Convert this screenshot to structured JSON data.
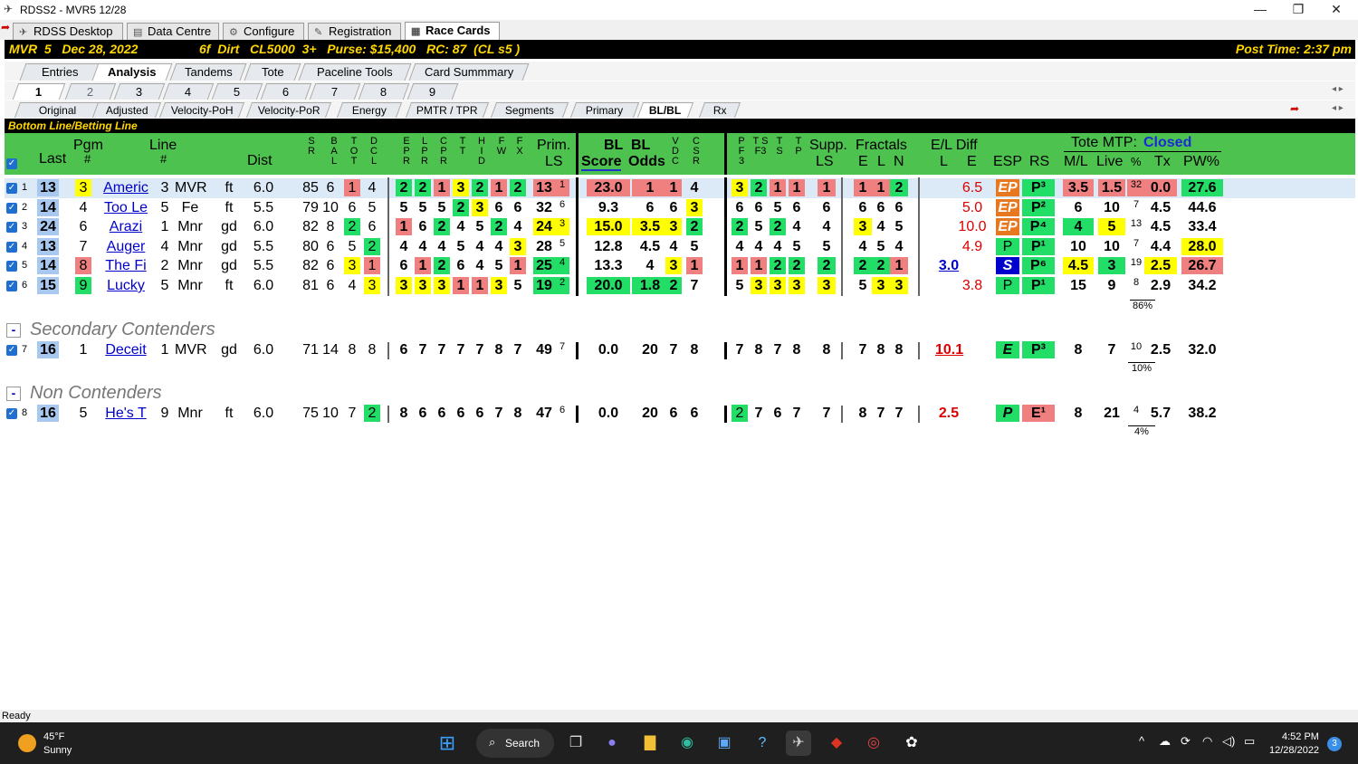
{
  "window": {
    "title": "RDSS2 - MVR5  12/28",
    "controls": [
      "—",
      "❐",
      "✕"
    ]
  },
  "app_tabs": [
    "RDSS Desktop",
    "Data Centre",
    "Configure",
    "Registration",
    "Race Cards"
  ],
  "race": {
    "info": "MVR  5   Dec 28, 2022",
    "cond": "6f  Dirt   CL5000  3+   Purse: $15,400   RC: 87  (CL s5 )",
    "post": "Post Time: 2:37 pm"
  },
  "view_tabs": [
    "Entries",
    "Analysis",
    "Tandems",
    "Tote",
    "Paceline Tools",
    "Card Summmary"
  ],
  "race_tabs": [
    "1",
    "2",
    "3",
    "4",
    "5",
    "6",
    "7",
    "8",
    "9"
  ],
  "sub_tabs": [
    "Original",
    "Adjusted",
    "Velocity-PoH",
    "Velocity-PoR",
    "Energy",
    "PMTR / TPR",
    "Segments",
    "Primary",
    "BL/BL",
    "Rx"
  ],
  "section_title": "Bottom Line/Betting Line",
  "headers": {
    "last": "Last",
    "pgm": "Pgm",
    "pgm2": "#",
    "line": "Line",
    "line2": "#",
    "dist": "Dist",
    "prim": "Prim.",
    "ls": "LS",
    "blscore": "BL",
    "score": "Score",
    "blodds": "BL",
    "odds": "Odds",
    "supp": "Supp.",
    "supp2": "LS",
    "fractals": "Fractals",
    "fe": "E",
    "fl": "L",
    "fn": "N",
    "eldiff": "E/L Diff",
    "el_l": "L",
    "el_e": "E",
    "esp": "ESP",
    "rs": "RS",
    "tote": "Tote MTP:",
    "tote_status": "Closed",
    "ml": "M/L",
    "live": "Live",
    "pct": "%",
    "tx": "Tx",
    "pw": "PW%",
    "sr": "S R",
    "bal": "B A L",
    "tot": "T O T",
    "dcl": "D C L",
    "epr": "E P R",
    "lpr": "L P R",
    "cpr": "C P R",
    "tt": "T T",
    "hid": "H I D",
    "fw": "F W",
    "fx": "F X",
    "vdc": "V D C",
    "csr": "C S R",
    "pf3": "P F 3",
    "tsf3": "T S F3",
    "ts": "T S",
    "tp": "T P"
  },
  "rows": [
    {
      "n": "1",
      "last": "13",
      "pgm": "3",
      "name": "Americ",
      "line": "3",
      "trk": "MVR",
      "cond": "ft",
      "dist": "6.0",
      "sr": "85",
      "bal": "6",
      "tot": "1",
      "dcl": "4",
      "epr": "2",
      "lpr": "2",
      "cpr": "1",
      "tt": "3",
      "hid": "2",
      "fw": "1",
      "fx": "2",
      "prim": "13",
      "primr": "1",
      "score": "23.0",
      "odds": "1",
      "vdc": "1",
      "csr": "4",
      "pf3": "3",
      "tsf3": "2",
      "ts": "1",
      "tp": "1",
      "supp": "1",
      "fe": "1",
      "fl": "1",
      "fn": "2",
      "ell": "",
      "ele": "6.5",
      "esp": "EP",
      "rs": "P³",
      "ml": "3.5",
      "live": "1.5",
      "pct": "32",
      "tx": "0.0",
      "pw": "27.6"
    },
    {
      "n": "2",
      "last": "14",
      "pgm": "4",
      "name": "Too Le",
      "line": "5",
      "trk": "Fe",
      "cond": "ft",
      "dist": "5.5",
      "sr": "79",
      "bal": "10",
      "tot": "6",
      "dcl": "5",
      "epr": "5",
      "lpr": "5",
      "cpr": "5",
      "tt": "2",
      "hid": "3",
      "fw": "6",
      "fx": "6",
      "prim": "32",
      "primr": "6",
      "score": "9.3",
      "odds": "6",
      "vdc": "6",
      "csr": "3",
      "pf3": "6",
      "tsf3": "6",
      "ts": "5",
      "tp": "6",
      "supp": "6",
      "fe": "6",
      "fl": "6",
      "fn": "6",
      "ell": "",
      "ele": "5.0",
      "esp": "EP",
      "rs": "P²",
      "ml": "6",
      "live": "10",
      "pct": "7",
      "tx": "4.5",
      "pw": "44.6"
    },
    {
      "n": "3",
      "last": "24",
      "pgm": "6",
      "name": "Arazi",
      "line": "1",
      "trk": "Mnr",
      "cond": "gd",
      "dist": "6.0",
      "sr": "82",
      "bal": "8",
      "tot": "2",
      "dcl": "6",
      "epr": "1",
      "lpr": "6",
      "cpr": "2",
      "tt": "4",
      "hid": "5",
      "fw": "2",
      "fx": "4",
      "prim": "24",
      "primr": "3",
      "score": "15.0",
      "odds": "3.5",
      "vdc": "3",
      "csr": "2",
      "pf3": "2",
      "tsf3": "5",
      "ts": "2",
      "tp": "4",
      "supp": "4",
      "fe": "3",
      "fl": "4",
      "fn": "5",
      "ell": "",
      "ele": "10.0",
      "esp": "EP",
      "rs": "P⁴",
      "ml": "4",
      "live": "5",
      "pct": "13",
      "tx": "4.5",
      "pw": "33.4"
    },
    {
      "n": "4",
      "last": "13",
      "pgm": "7",
      "name": "Auger",
      "line": "4",
      "trk": "Mnr",
      "cond": "gd",
      "dist": "5.5",
      "sr": "80",
      "bal": "6",
      "tot": "5",
      "dcl": "2",
      "epr": "4",
      "lpr": "4",
      "cpr": "4",
      "tt": "5",
      "hid": "4",
      "fw": "4",
      "fx": "3",
      "prim": "28",
      "primr": "5",
      "score": "12.8",
      "odds": "4.5",
      "vdc": "4",
      "csr": "5",
      "pf3": "4",
      "tsf3": "4",
      "ts": "4",
      "tp": "5",
      "supp": "5",
      "fe": "4",
      "fl": "5",
      "fn": "4",
      "ell": "",
      "ele": "4.9",
      "esp": "P",
      "rs": "P¹",
      "ml": "10",
      "live": "10",
      "pct": "7",
      "tx": "4.4",
      "pw": "28.0"
    },
    {
      "n": "5",
      "last": "14",
      "pgm": "8",
      "name": "The Fi",
      "line": "2",
      "trk": "Mnr",
      "cond": "gd",
      "dist": "5.5",
      "sr": "82",
      "bal": "6",
      "tot": "3",
      "dcl": "1",
      "epr": "6",
      "lpr": "1",
      "cpr": "2",
      "tt": "6",
      "hid": "4",
      "fw": "5",
      "fx": "1",
      "prim": "25",
      "primr": "4",
      "score": "13.3",
      "odds": "4",
      "vdc": "3",
      "csr": "1",
      "pf3": "1",
      "tsf3": "1",
      "ts": "2",
      "tp": "2",
      "supp": "2",
      "fe": "2",
      "fl": "2",
      "fn": "1",
      "ell": "3.0",
      "ele": "",
      "esp": "S",
      "rs": "P⁶",
      "ml": "4.5",
      "live": "3",
      "pct": "19",
      "tx": "2.5",
      "pw": "26.7"
    },
    {
      "n": "6",
      "last": "15",
      "pgm": "9",
      "name": "Lucky",
      "line": "5",
      "trk": "Mnr",
      "cond": "ft",
      "dist": "6.0",
      "sr": "81",
      "bal": "6",
      "tot": "4",
      "dcl": "3",
      "epr": "3",
      "lpr": "3",
      "cpr": "3",
      "tt": "1",
      "hid": "1",
      "fw": "3",
      "fx": "5",
      "prim": "19",
      "primr": "2",
      "score": "20.0",
      "odds": "1.8",
      "vdc": "2",
      "csr": "7",
      "pf3": "5",
      "tsf3": "3",
      "ts": "3",
      "tp": "3",
      "supp": "3",
      "fe": "5",
      "fl": "3",
      "fn": "3",
      "ell": "",
      "ele": "3.8",
      "esp": "P",
      "rs": "P¹",
      "ml": "15",
      "live": "9",
      "pct": "8",
      "tx": "2.9",
      "pw": "34.2"
    }
  ],
  "total_pct": "86%",
  "secondary_label": "Secondary Contenders",
  "secondary": {
    "n": "7",
    "last": "16",
    "pgm": "1",
    "name": "Deceit",
    "line": "1",
    "trk": "MVR",
    "cond": "gd",
    "dist": "6.0",
    "sr": "71",
    "bal": "14",
    "tot": "8",
    "dcl": "8",
    "epr": "6",
    "lpr": "7",
    "cpr": "7",
    "tt": "7",
    "hid": "7",
    "fw": "8",
    "fx": "7",
    "prim": "49",
    "primr": "7",
    "score": "0.0",
    "odds": "20",
    "vdc": "7",
    "csr": "8",
    "pf3": "7",
    "tsf3": "8",
    "ts": "7",
    "tp": "8",
    "supp": "8",
    "fe": "7",
    "fl": "8",
    "fn": "8",
    "ell": "10.1",
    "esp": "E",
    "rs": "P³",
    "ml": "8",
    "live": "7",
    "pct": "10",
    "tx": "2.5",
    "pw": "32.0",
    "sub": "10%"
  },
  "non_label": "Non Contenders",
  "non": {
    "n": "8",
    "last": "16",
    "pgm": "5",
    "name": "He's T",
    "line": "9",
    "trk": "Mnr",
    "cond": "ft",
    "dist": "6.0",
    "sr": "75",
    "bal": "10",
    "tot": "7",
    "dcl": "2",
    "epr": "8",
    "lpr": "6",
    "cpr": "6",
    "tt": "6",
    "hid": "6",
    "fw": "7",
    "fx": "8",
    "prim": "47",
    "primr": "6",
    "score": "0.0",
    "odds": "20",
    "vdc": "6",
    "csr": "6",
    "pf3": "2",
    "tsf3": "7",
    "ts": "6",
    "tp": "7",
    "supp": "7",
    "fe": "8",
    "fl": "7",
    "fn": "7",
    "ell": "2.5",
    "esp": "P",
    "rs": "E¹",
    "ml": "8",
    "live": "21",
    "pct": "4",
    "tx": "5.7",
    "pw": "38.2",
    "sub": "4%"
  },
  "status": "Ready",
  "taskbar": {
    "temp": "45°F",
    "weather": "Sunny",
    "search": "Search",
    "time": "4:52 PM",
    "date": "12/28/2022",
    "badge": "3"
  }
}
